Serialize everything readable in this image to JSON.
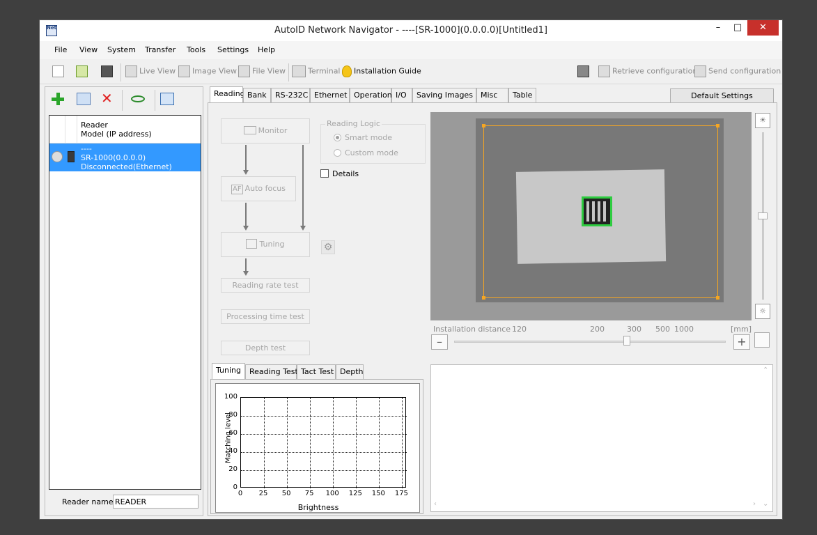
{
  "window": {
    "title": "AutoID Network Navigator - ----[SR-1000](0.0.0.0)[Untitled1]",
    "app_icon": "Net",
    "minimize": "–",
    "maximize": "□",
    "close": "✕"
  },
  "menu": [
    "File",
    "View",
    "System",
    "Transfer",
    "Tools",
    "Settings",
    "Help"
  ],
  "toolbar": {
    "live_view": "Live View",
    "image_view": "Image View",
    "file_view": "File View",
    "terminal": "Terminal",
    "installation_guide": "Installation Guide",
    "retrieve": "Retrieve configuration",
    "send": "Send configuration"
  },
  "left": {
    "header_line1": "Reader",
    "header_line2": "Model (IP address)",
    "reader": {
      "line1": "----",
      "line2": "SR-1000(0.0.0.0)",
      "line3": "Disconnected(Ethernet)"
    },
    "reader_name_label": "Reader name",
    "reader_name_value": "READER"
  },
  "tabs": [
    "Reading",
    "Bank",
    "RS-232C",
    "Ethernet",
    "Operation",
    "I/O",
    "Saving Images",
    "Misc",
    "Table"
  ],
  "default_settings": "Default Settings",
  "flow": {
    "monitor": "Monitor",
    "auto_focus": "Auto focus",
    "af_icon": "AF",
    "tuning": "Tuning",
    "reading_rate": "Reading rate test",
    "processing_time": "Processing time test",
    "depth_test": "Depth test"
  },
  "reading_logic": {
    "legend": "Reading Logic",
    "smart": "Smart mode",
    "custom": "Custom mode",
    "details": "Details"
  },
  "bottom_tabs": [
    "Tuning",
    "Reading Test",
    "Tact Test",
    "Depth"
  ],
  "chart_data": {
    "type": "line",
    "xlabel": "Brightness",
    "ylabel": "Matching level",
    "x_ticks": [
      "0",
      "25",
      "50",
      "75",
      "100",
      "125",
      "150",
      "175"
    ],
    "y_ticks": [
      "0",
      "20",
      "40",
      "60",
      "80",
      "100"
    ],
    "xlim": [
      0,
      180
    ],
    "ylim": [
      0,
      100
    ],
    "grid": true,
    "series": []
  },
  "install": {
    "label": "Installation distance",
    "ticks": [
      "120",
      "200",
      "300",
      "500",
      "1000"
    ],
    "unit": "[mm]",
    "slider_value": "300",
    "minus": "–",
    "plus": "+"
  },
  "colors": {
    "selection": "#3399ff",
    "roi": "#f5a623",
    "code_box": "#2ecc40",
    "add_icon": "#2aa52a",
    "delete_icon": "#e02020",
    "close_button": "#c7302b"
  }
}
